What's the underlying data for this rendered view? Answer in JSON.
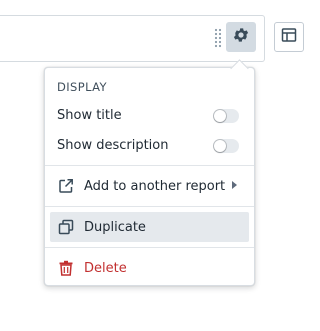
{
  "toolbar": {
    "drag_icon": "drag-handle-icon",
    "settings_icon": "gear-icon",
    "layout_icon": "layout-panel-icon"
  },
  "menu": {
    "header": "DISPLAY",
    "show_title": {
      "label": "Show title",
      "enabled": false
    },
    "show_description": {
      "label": "Show description",
      "enabled": false
    },
    "add_to_report": {
      "label": "Add to another report",
      "icon": "share-icon"
    },
    "duplicate": {
      "label": "Duplicate",
      "icon": "duplicate-icon"
    },
    "delete": {
      "label": "Delete",
      "icon": "trash-icon"
    }
  },
  "colors": {
    "danger": "#c23030",
    "active_bg": "#e5e9ed",
    "gear_button_bg": "#d3dbe2"
  }
}
